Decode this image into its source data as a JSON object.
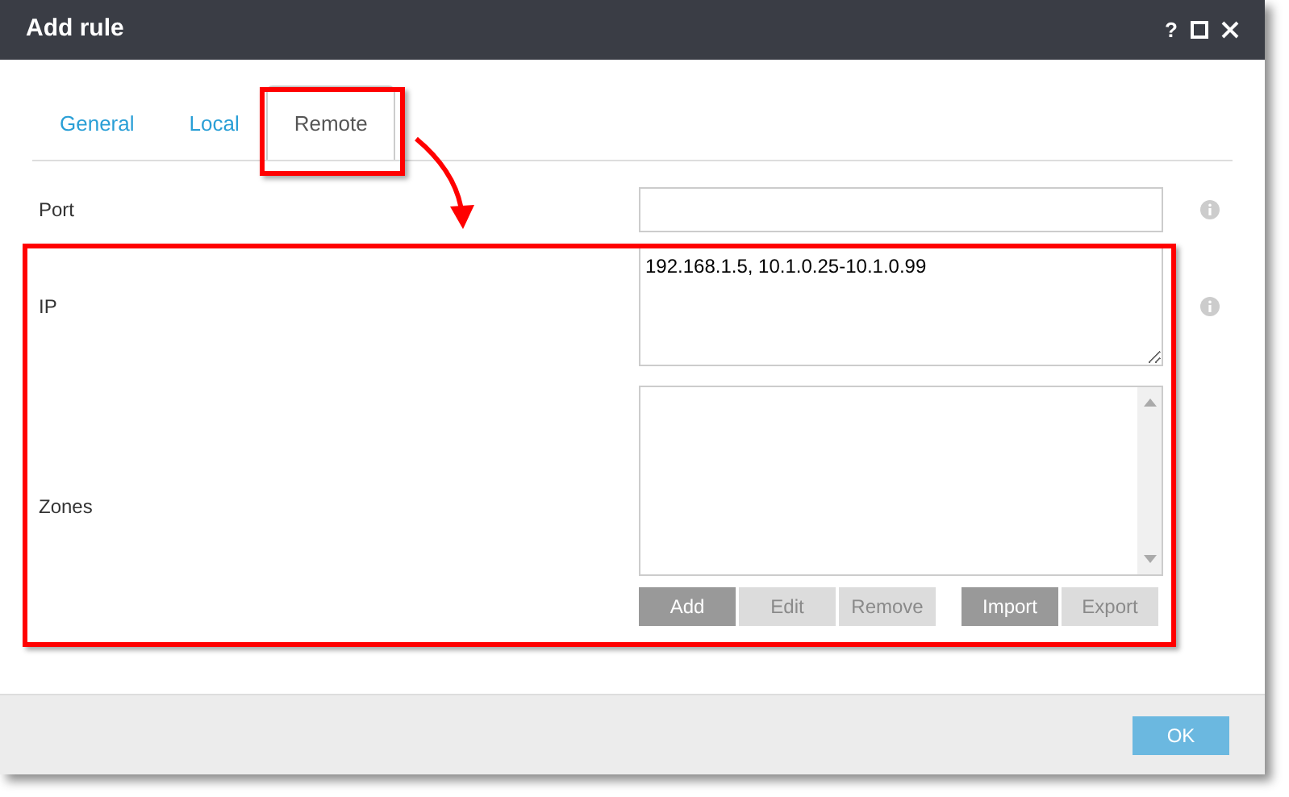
{
  "window": {
    "title": "Add rule",
    "help": "?"
  },
  "tabs": [
    {
      "label": "General",
      "selected": false
    },
    {
      "label": "Local",
      "selected": false
    },
    {
      "label": "Remote",
      "selected": true
    }
  ],
  "fields": [
    {
      "kind": "input",
      "label": "Port",
      "info": true
    },
    {
      "kind": "textarea",
      "label": "IP",
      "value": "192.168.1.5, 10.1.0.25-10.1.0.99",
      "info": true
    },
    {
      "kind": "list",
      "label": "Zones",
      "info": false,
      "button_groups": [
        [
          {
            "label": "Add",
            "disabled": false
          },
          {
            "label": "Edit",
            "disabled": true
          },
          {
            "label": "Remove",
            "disabled": true
          }
        ],
        [
          {
            "label": "Import",
            "disabled": false
          },
          {
            "label": "Export",
            "disabled": true
          }
        ]
      ]
    }
  ],
  "footer": {
    "ok": "OK"
  }
}
